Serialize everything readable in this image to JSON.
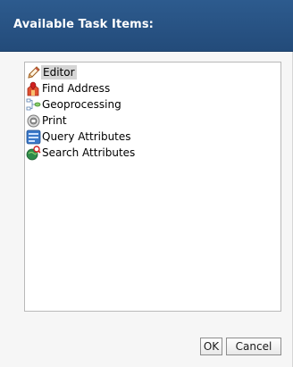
{
  "dialog": {
    "title": "Available Task Items:",
    "items": [
      {
        "label": "Editor",
        "icon": "pencil-icon",
        "selected": true
      },
      {
        "label": "Find Address",
        "icon": "find-address-icon",
        "selected": false
      },
      {
        "label": "Geoprocessing",
        "icon": "geoprocessing-icon",
        "selected": false
      },
      {
        "label": "Print",
        "icon": "print-icon",
        "selected": false
      },
      {
        "label": "Query Attributes",
        "icon": "query-attributes-icon",
        "selected": false
      },
      {
        "label": "Search Attributes",
        "icon": "search-attributes-icon",
        "selected": false
      }
    ],
    "buttons": {
      "ok_label": "OK",
      "cancel_label": "Cancel"
    }
  },
  "colors": {
    "titlebar": "#2d5b8e",
    "selection": "#d5d5d5"
  }
}
